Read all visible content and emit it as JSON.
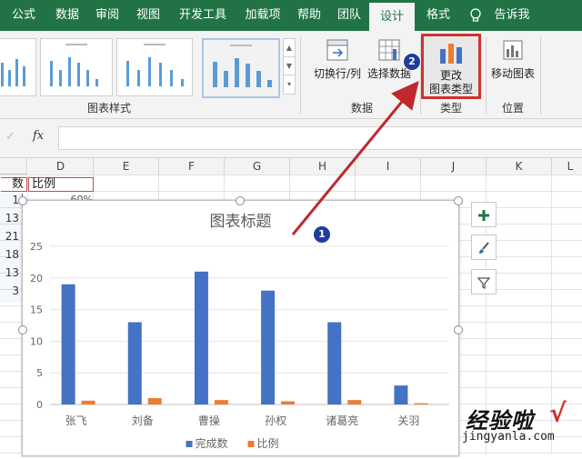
{
  "tabs": [
    "公式",
    "数据",
    "审阅",
    "视图",
    "开发工具",
    "加载项",
    "帮助",
    "团队",
    "设计",
    "格式",
    "告诉我"
  ],
  "ribbon": {
    "chart_styles_label": "图表样式",
    "data_group_label": "数据",
    "type_group_label": "类型",
    "position_group_label": "位置",
    "switch_row_col": "切换行/列",
    "select_data": "选择数据",
    "change_type_line1": "更改",
    "change_type_line2": "图表类型",
    "move_chart": "移动图表"
  },
  "formula_bar": {
    "fx": "fx",
    "cancel": "✓"
  },
  "columns": [
    "D",
    "E",
    "F",
    "G",
    "H",
    "I",
    "J",
    "K",
    "L"
  ],
  "cells": {
    "c_header_partial": "数",
    "d_header": "比例",
    "d2_partial": "60%",
    "c_values_partial": [
      "1",
      "13",
      "21",
      "18",
      "13",
      "3"
    ]
  },
  "chart": {
    "title": "图表标题",
    "legend": [
      "完成数",
      "比例"
    ],
    "colors": {
      "series1": "#4472c4",
      "series2": "#ed7d31"
    }
  },
  "chart_data": {
    "type": "bar",
    "title": "图表标题",
    "categories": [
      "张飞",
      "刘备",
      "曹操",
      "孙权",
      "诸葛亮",
      "关羽"
    ],
    "series": [
      {
        "name": "完成数",
        "values": [
          19,
          13,
          21,
          18,
          13,
          3
        ]
      },
      {
        "name": "比例",
        "values": [
          0.6,
          1.0,
          0.7,
          0.5,
          0.7,
          0.2
        ]
      }
    ],
    "ylim": [
      0,
      25
    ],
    "yticks": [
      0,
      5,
      10,
      15,
      20,
      25
    ],
    "grid": true,
    "legend_position": "bottom"
  },
  "annotations": {
    "badge1": "1",
    "badge2": "2"
  },
  "watermark": {
    "text": "经验啦",
    "url": "jingyanla.com",
    "check": "√"
  }
}
